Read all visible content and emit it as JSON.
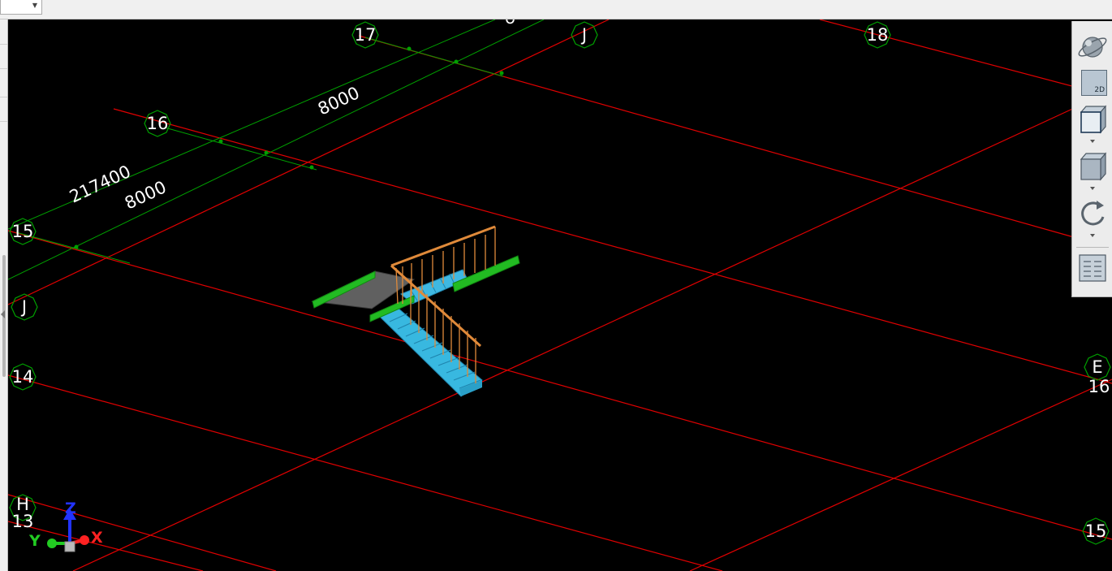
{
  "toolbar_top": {
    "view_dropdown_value": ""
  },
  "viewport": {
    "grid_bubbles": [
      {
        "id": "bubble-17",
        "label": "17"
      },
      {
        "id": "bubble-j-top",
        "label": "J"
      },
      {
        "id": "bubble-18",
        "label": "18"
      },
      {
        "id": "bubble-16",
        "label": "16"
      },
      {
        "id": "bubble-15",
        "label": "15"
      },
      {
        "id": "bubble-j-left",
        "label": "J"
      },
      {
        "id": "bubble-14",
        "label": "14"
      },
      {
        "id": "bubble-e",
        "label": "E"
      },
      {
        "id": "bubble-16-right",
        "label": "16"
      },
      {
        "id": "bubble-h",
        "label": "H"
      },
      {
        "id": "bubble-13",
        "label": "13"
      },
      {
        "id": "bubble-15-right",
        "label": "15"
      }
    ],
    "dimensions": [
      {
        "id": "dim-8000-top",
        "label": "8000"
      },
      {
        "id": "dim-217400",
        "label": "217400"
      },
      {
        "id": "dim-8000-left",
        "label": "8000"
      }
    ],
    "axis_gizmo": {
      "x_label": "X",
      "y_label": "Y",
      "z_label": "Z"
    },
    "colors": {
      "grid_red": "#e00000",
      "grid_green": "#00a000",
      "stair_blue": "#38b8e0",
      "landing_green": "#22bb22",
      "rail_orange": "#e08a3a",
      "bubble_outline": "#00a000"
    }
  },
  "view_toolbar": {
    "buttons": [
      {
        "id": "orbit-button",
        "icon": "orbit-icon"
      },
      {
        "id": "view-2d-button",
        "icon": "view-2d-icon",
        "label": "2D"
      },
      {
        "id": "view-3d-box-button",
        "icon": "cube-front-icon"
      },
      {
        "id": "view-3d-solid-button",
        "icon": "cube-icon"
      },
      {
        "id": "rotate-button",
        "icon": "rotate-icon"
      },
      {
        "id": "properties-button",
        "icon": "list-icon"
      }
    ]
  }
}
